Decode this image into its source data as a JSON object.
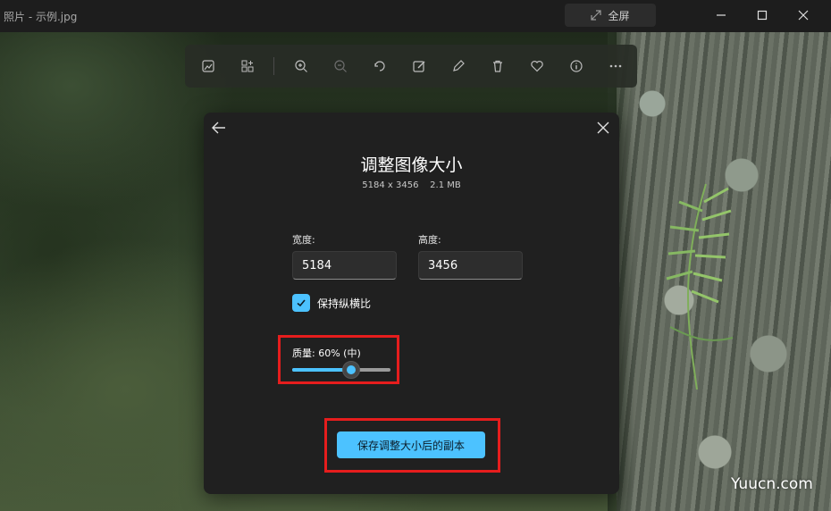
{
  "window": {
    "title": "照片 - 示例.jpg",
    "fullscreen_label": "全屏"
  },
  "toolbar": {
    "icons": [
      "image-icon",
      "apps-icon",
      "zoom-in-icon",
      "zoom-out-icon",
      "rotate-icon",
      "edit-image-icon",
      "draw-icon",
      "delete-icon",
      "favorite-heart-icon",
      "info-icon",
      "more-icon"
    ]
  },
  "dialog": {
    "title": "调整图像大小",
    "subtitle": "5184 x 3456    2.1 MB",
    "width_label": "宽度:",
    "width_value": "5184",
    "height_label": "高度:",
    "height_value": "3456",
    "keep_aspect_label": "保持纵横比",
    "keep_aspect_checked": true,
    "quality_label": "质量: 60% (中)",
    "quality_percent": 60,
    "save_label": "保存调整大小后的副本"
  },
  "watermark": "Yuucn.com",
  "colors": {
    "accent": "#4cc2ff",
    "annotation": "#e61d1d",
    "dialog_bg": "#202020"
  }
}
